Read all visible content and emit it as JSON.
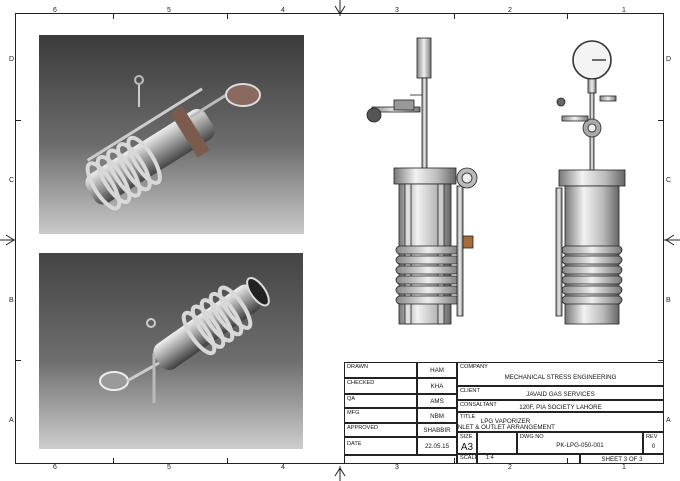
{
  "drawing": {
    "zones_top": [
      "6",
      "5",
      "4",
      "3",
      "2",
      "1"
    ],
    "zones_bottom": [
      "6",
      "5",
      "4",
      "3",
      "2",
      "1"
    ],
    "zones_left": [
      "D",
      "C",
      "B",
      "A"
    ],
    "zones_right": [
      "D",
      "C",
      "B",
      "A"
    ]
  },
  "title_block": {
    "drawn_label": "DRAWN",
    "drawn_value": "HAM",
    "checked_label": "CHECKED",
    "checked_value": "KHA",
    "qa_label": "QA",
    "qa_value": "AMS",
    "mfg_label": "MFG",
    "mfg_value": "NBM",
    "approved_label": "APPROVED",
    "approved_value": "SHABBIR",
    "date_label": "DATE",
    "date_value": "22.05.15",
    "company_label": "COMPANY",
    "company_value": "MECHANICAL STRESS ENGINEERING",
    "client_label": "CLIENT",
    "client_value": "JAVAID GAS SERVICES",
    "consultant_label": "CONSALTANT",
    "consultant_value": "120F, PIA SOCIETY LAHORE",
    "title_label": "TITLE",
    "title_line1": "LPG VAPORIZER",
    "title_line2": "INLET & OUTLET ARRANGEMENT",
    "size_label": "SIZE",
    "size_value": "A3",
    "dwg_label": "DWG NO",
    "dwg_value": "PK-LPG-050-001",
    "rev_label": "REV",
    "rev_value": "0",
    "scale_label": "SCALE",
    "scale_value": "1:4",
    "sheet_value": "SHEET 3  OF 3"
  }
}
